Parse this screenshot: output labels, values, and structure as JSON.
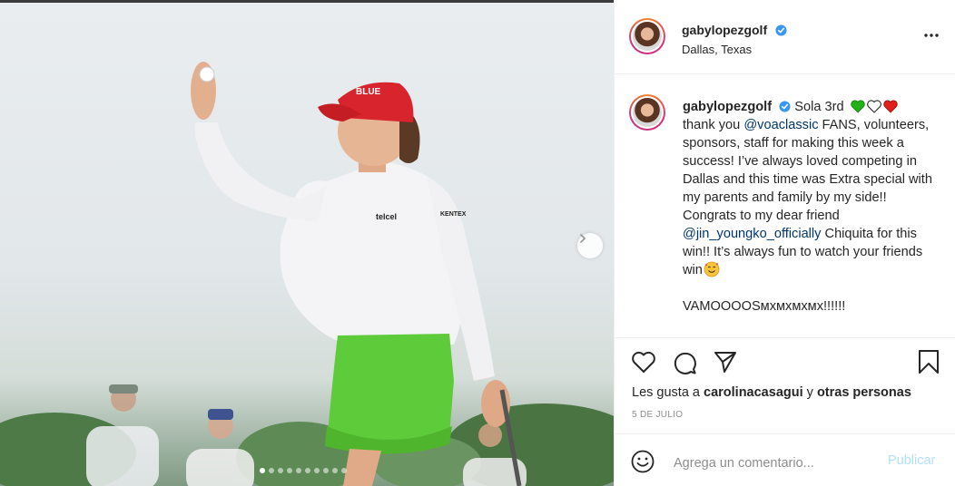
{
  "post": {
    "username": "gabylopezgolf",
    "verified": true,
    "location": "Dallas, Texas",
    "caption": {
      "intro": "Sola 3rd",
      "hearts": [
        "green-heart",
        "white-heart",
        "red-heart"
      ],
      "line_thank": "thank you",
      "mention1": "@voaclassic",
      "after_mention1": " FANS, volunteers, sponsors, staff for making this week a success! I’ve always loved competing in Dallas and this time was Extra special with my parents and family by my side!! Congrats to my dear friend",
      "mention2": "@jin_youngko_officially",
      "after_mention2": " Chiquita for this win!! It’s always fun to watch your friends win",
      "emoji_end": "smiling-face-with-hearts",
      "closing": "VAMOOOOSмхмхмхмх!!!!!!"
    },
    "likes": {
      "prefix": "Les gusta a",
      "user": "carolinacasagui",
      "joiner": "y",
      "others": "otras personas"
    },
    "date": "5 DE JULIO",
    "comment": {
      "placeholder": "Agrega un comentario...",
      "publish_label": "Publicar"
    },
    "carousel": {
      "total": 10,
      "active_index": 0
    }
  },
  "colors": {
    "link": "#00376b",
    "verified_blue": "#3897f0",
    "publish_disabled": "#b2dffc",
    "skirt_green": "#5ecb3a",
    "cap_red": "#d8242c"
  },
  "icons": [
    "verified-icon",
    "more-options-icon",
    "heart-icon",
    "comment-icon",
    "share-icon",
    "bookmark-icon",
    "emoji-icon",
    "chevron-right-icon"
  ]
}
